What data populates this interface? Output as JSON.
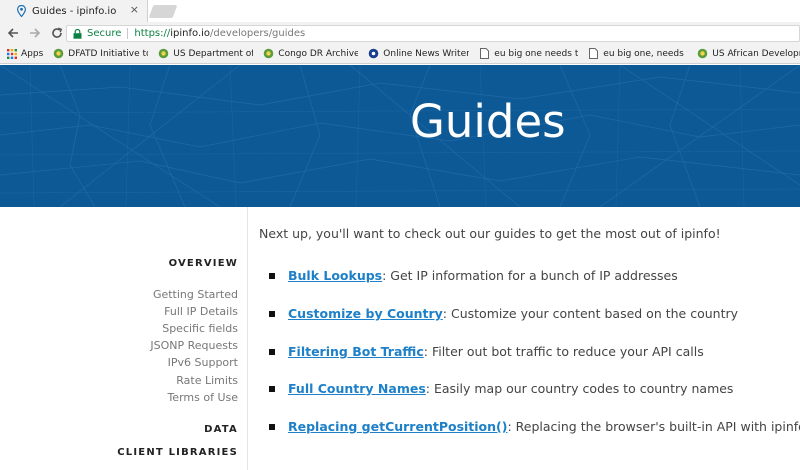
{
  "browser": {
    "tab": {
      "title": "Guides - ipinfo.io",
      "close": "×"
    },
    "nav": {
      "back": "←",
      "forward": "→",
      "reload": "C"
    },
    "address": {
      "secure_label": "Secure",
      "scheme": "https://",
      "host": "ipinfo.io",
      "path": "/developers/guides"
    },
    "bookmarks": [
      {
        "label": "Apps",
        "icon": "apps-grid-icon"
      },
      {
        "label": "DFATD Initiative to Su",
        "icon": "globe-icon"
      },
      {
        "label": "US Department of St",
        "icon": "globe-icon"
      },
      {
        "label": "Congo DR Archives -",
        "icon": "globe-icon"
      },
      {
        "label": "Online News Writer j",
        "icon": "blue-circle-icon"
      },
      {
        "label": "eu big one needs two",
        "icon": "page-icon"
      },
      {
        "label": "eu big one, needs tw",
        "icon": "page-icon"
      },
      {
        "label": "US African Developm",
        "icon": "globe-icon"
      }
    ]
  },
  "hero": {
    "title": "Guides",
    "bg_color": "#0d5996"
  },
  "sidebar": {
    "overview_heading": "OVERVIEW",
    "links": [
      "Getting Started",
      "Full IP Details",
      "Specific fields",
      "JSONP Requests",
      "IPv6 Support",
      "Rate Limits",
      "Terms of Use"
    ],
    "data_heading": "DATA",
    "client_libraries_heading": "CLIENT LIBRARIES"
  },
  "main": {
    "intro": "Next up, you'll want to check out our guides to get the most out of ipinfo!",
    "guides": [
      {
        "title": "Bulk Lookups",
        "desc": ": Get IP information for a bunch of IP addresses"
      },
      {
        "title": "Customize by Country",
        "desc": ": Customize your content based on the country"
      },
      {
        "title": "Filtering Bot Traffic",
        "desc": ": Filter out bot traffic to reduce your API calls"
      },
      {
        "title": "Full Country Names",
        "desc": ": Easily map our country codes to country names"
      },
      {
        "title": "Replacing getCurrentPosition()",
        "desc": ": Replacing the browser's built-in API with ipinfo."
      }
    ]
  },
  "colors": {
    "link": "#1d80c8",
    "secure_green": "#0b8043",
    "hero_blue": "#0d5996"
  }
}
